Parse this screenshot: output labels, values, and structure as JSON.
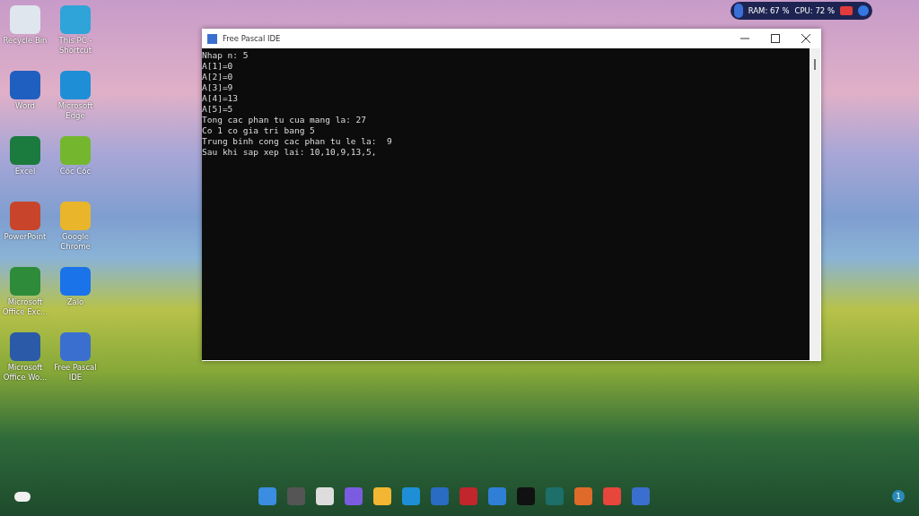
{
  "desktop_icons": [
    {
      "label": "Recycle Bin"
    },
    {
      "label": "This PC - Shortcut"
    },
    {
      "label": "Word"
    },
    {
      "label": "Microsoft Edge"
    },
    {
      "label": "Excel"
    },
    {
      "label": "Cốc Cốc"
    },
    {
      "label": "PowerPoint"
    },
    {
      "label": "Google Chrome"
    },
    {
      "label": "Microsoft Office Exc..."
    },
    {
      "label": "Zalo"
    },
    {
      "label": "Microsoft Office Wo..."
    },
    {
      "label": "Free Pascal IDE"
    }
  ],
  "system_monitor": {
    "ram": "RAM: 67 %",
    "cpu": "CPU: 72 %"
  },
  "window": {
    "title": "Free Pascal IDE",
    "console_lines": [
      "Nhap n: 5",
      "A[1]=0",
      "A[2]=0",
      "A[3]=9",
      "A[4]=13",
      "A[5]=5",
      "Tong cac phan tu cua mang la: 27",
      "Co 1 co gia tri bang 5",
      "Trung binh cong cac phan tu le la:  9",
      "Sau khi sap xep lai: 10,10,9,13,5,"
    ]
  },
  "taskbar": {
    "notification_count": "1"
  }
}
